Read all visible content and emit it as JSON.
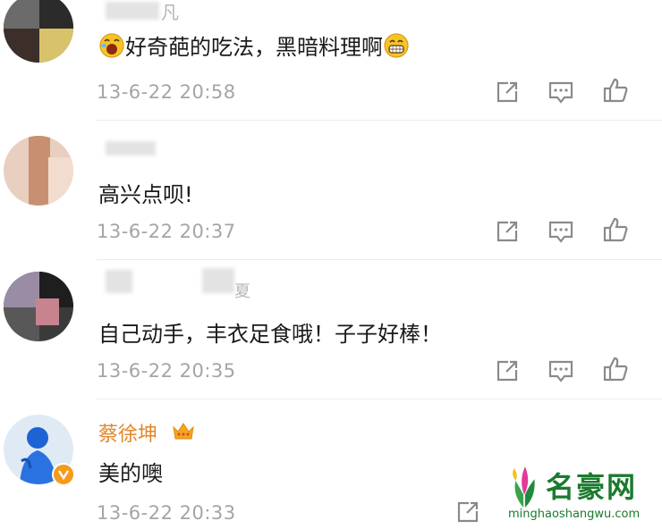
{
  "comments": [
    {
      "username": "凡",
      "text": "好奇葩的吃法，黑暗料理啊",
      "time": "13-6-22 20:58",
      "icons": [
        "laughing-emoji",
        "grinning-emoji",
        "share-icon",
        "comment-icon",
        "like-icon"
      ]
    },
    {
      "username": "",
      "text": "高兴点呗!",
      "time": "13-6-22 20:37",
      "icons": [
        "share-icon",
        "comment-icon",
        "like-icon"
      ]
    },
    {
      "username": "夏",
      "text": "自己动手，丰衣足食哦！子子好棒！",
      "time": "13-6-22 20:35",
      "icons": [
        "share-icon",
        "comment-icon",
        "like-icon"
      ]
    },
    {
      "username": "蔡徐坤",
      "text": "美的噢",
      "time": "13-6-22 20:33",
      "icons": [
        "crown-icon",
        "verified-badge-icon",
        "share-icon"
      ]
    }
  ],
  "watermark": {
    "name": "名豪网",
    "url": "minghaoshangwu.com"
  },
  "colors": {
    "username_highlight": "#e0872a",
    "timestamp": "#a5a5a5",
    "icon": "#8a8a8a",
    "watermark_text": "#1b7a2e"
  }
}
